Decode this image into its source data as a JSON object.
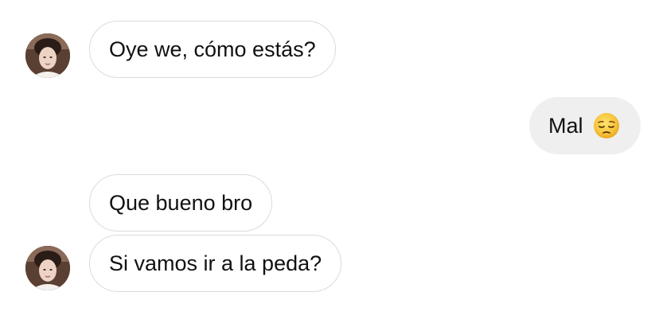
{
  "messages": [
    {
      "text": "Oye we, cómo estás?",
      "direction": "incoming"
    },
    {
      "text": "Mal",
      "emoji": "pensive-face",
      "direction": "outgoing"
    },
    {
      "text": "Que bueno bro",
      "direction": "incoming"
    },
    {
      "text": "Si vamos ir a la peda?",
      "direction": "incoming"
    }
  ],
  "colors": {
    "incoming_bubble_bg": "#ffffff",
    "incoming_bubble_border": "#dbdbdb",
    "outgoing_bubble_bg": "#efefef",
    "text": "#111111"
  },
  "icons": {
    "avatar": "contact-avatar-photo",
    "emoji": "pensive-face-emoji"
  }
}
